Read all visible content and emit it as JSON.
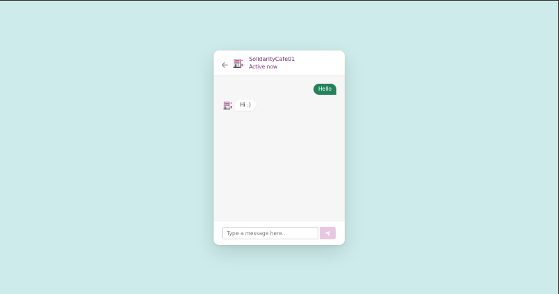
{
  "header": {
    "contact_name": "SolidarityCafe01",
    "status": "Active now"
  },
  "messages": [
    {
      "direction": "sent",
      "text": "Hello"
    },
    {
      "direction": "received",
      "text": "Hi :)"
    }
  ],
  "composer": {
    "placeholder": "Type a message here...",
    "value": ""
  },
  "icons": {
    "back": "arrow-left-icon",
    "avatar": "cafe-avatar-icon",
    "send": "paper-plane-icon"
  },
  "colors": {
    "page_background": "#cdebea",
    "accent_purple": "#6b2d6b",
    "sent_bubble": "#24825a",
    "send_button": "#e6c8e0"
  }
}
